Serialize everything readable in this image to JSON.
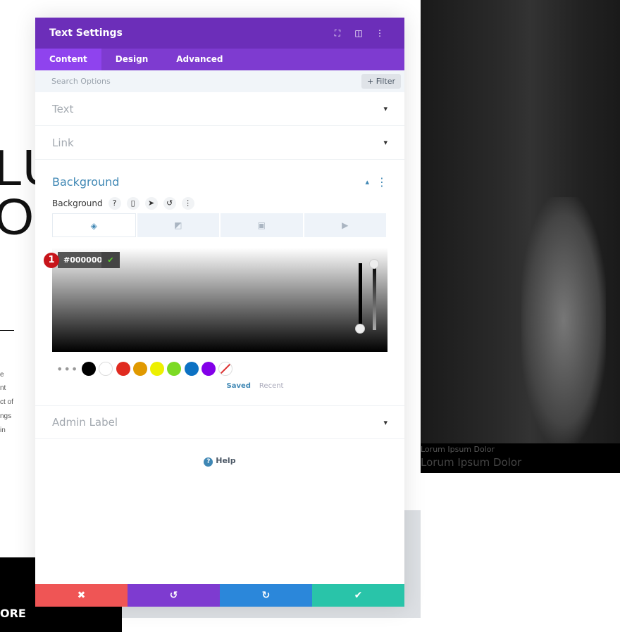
{
  "background_page": {
    "big_lines": [
      "LU",
      "OC"
    ],
    "body_fragments": [
      "e",
      "nt",
      "ct of",
      "ngs",
      "in"
    ],
    "button_text": "ORE",
    "captions": [
      "Lorum Ipsum Dolor",
      "Lorum Ipsum Dolor"
    ]
  },
  "modal": {
    "title": "Text Settings",
    "header_icons": [
      "fullscreen-icon",
      "split-view-icon",
      "more-icon"
    ],
    "tabs": [
      {
        "label": "Content",
        "active": true
      },
      {
        "label": "Design"
      },
      {
        "label": "Advanced"
      }
    ],
    "search_placeholder": "Search Options",
    "filter_label": "+ Filter",
    "sections": {
      "text": "Text",
      "link": "Link",
      "background": "Background",
      "admin": "Admin Label"
    },
    "background": {
      "control_label": "Background",
      "help": "?",
      "hex_value": "#000000",
      "badge": "1",
      "swatches": [
        "#000000",
        "#ffffff",
        "#e02b20",
        "#e09900",
        "#edf000",
        "#7cda24",
        "#0c71c3",
        "#8300e9"
      ],
      "saved_label": "Saved",
      "recent_label": "Recent"
    },
    "help_label": "Help",
    "footer_colors": {
      "cancel": "#ef5555",
      "undo": "#7e3bd0",
      "redo": "#2b87da",
      "save": "#29c4a9"
    }
  }
}
